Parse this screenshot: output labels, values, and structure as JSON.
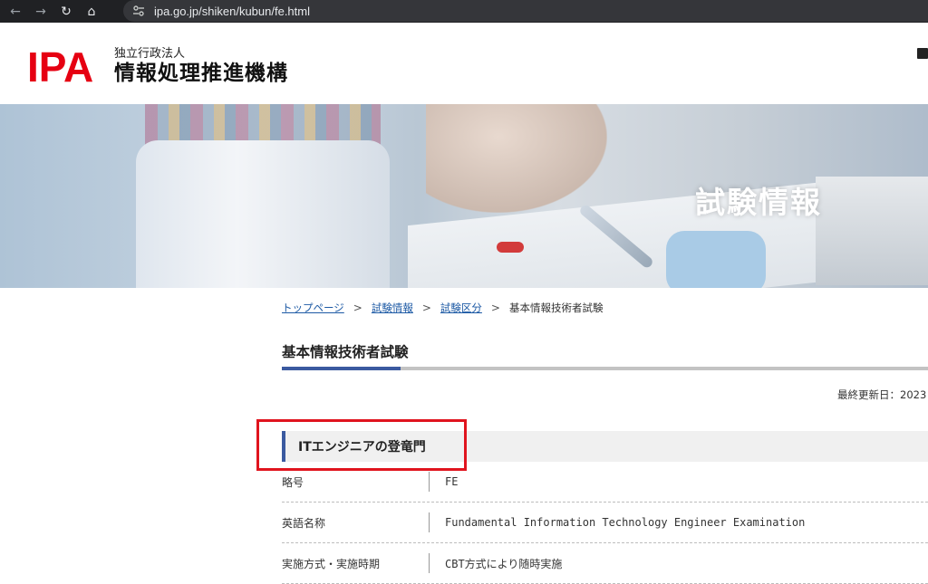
{
  "browser": {
    "back_icon": "arrow-left-icon",
    "forward_icon": "arrow-right-icon",
    "reload_icon": "reload-icon",
    "home_icon": "home-icon",
    "url": "ipa.go.jp/shiken/kubun/fe.html"
  },
  "header": {
    "logo_text": "IPA",
    "org_sub": "独立行政法人",
    "org_main": "情報処理推進機構",
    "brand_color": "#e60012"
  },
  "hero": {
    "title": "試験情報"
  },
  "breadcrumb": {
    "items": [
      "トップページ",
      "試験情報",
      "試験区分"
    ],
    "separator": ">",
    "current": "基本情報技術者試験"
  },
  "page": {
    "title": "基本情報技術者試験",
    "updated": "最終更新日：2023",
    "accent_color": "#3b5aa0"
  },
  "section": {
    "heading": "ITエンジニアの登竜門",
    "highlight_color": "#e0141e"
  },
  "info": {
    "rows": [
      {
        "label": "略号",
        "value": "FE"
      },
      {
        "label": "英語名称",
        "value": "Fundamental Information Technology Engineer Examination"
      },
      {
        "label": "実施方式・実施時期",
        "value": "CBT方式により随時実施"
      }
    ]
  }
}
